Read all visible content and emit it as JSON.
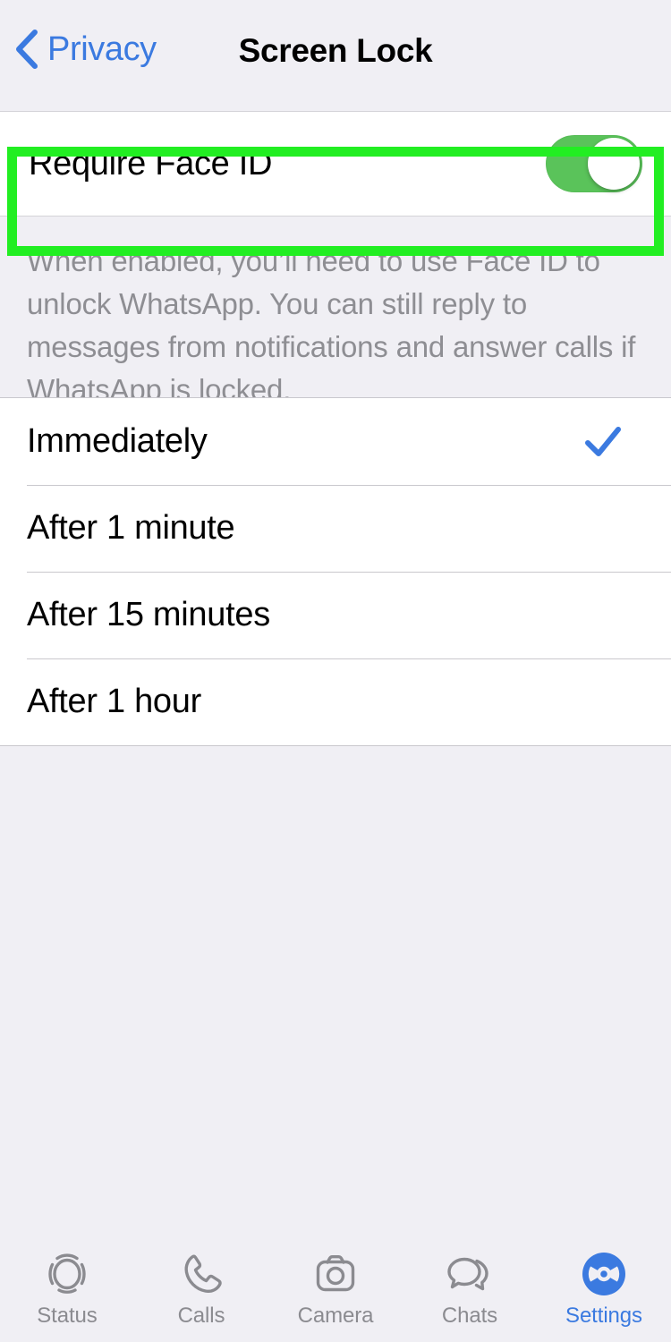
{
  "navbar": {
    "back_label": "Privacy",
    "back_icon": "chevron-left-icon",
    "title": "Screen Lock"
  },
  "face_id_setting": {
    "label": "Require Face ID",
    "toggle_state": "on",
    "toggle_on_color": "#5ac35a",
    "highlighted": true,
    "highlight_color": "#22ee22",
    "description": "When enabled, you’ll need to use Face ID to unlock WhatsApp. You can still reply to messages from notifications and answer calls if WhatsApp is locked."
  },
  "lock_timing": {
    "selected": "Immediately",
    "check_color": "#3b7ae0",
    "options": [
      {
        "label": "Immediately",
        "selected": true
      },
      {
        "label": "After 1 minute",
        "selected": false
      },
      {
        "label": "After 15 minutes",
        "selected": false
      },
      {
        "label": "After 1 hour",
        "selected": false
      }
    ]
  },
  "tabbar": {
    "active": "Settings",
    "active_color": "#3b7ae0",
    "inactive_color": "#8b8b90",
    "items": [
      {
        "label": "Status",
        "icon": "status-rings-icon",
        "active": false
      },
      {
        "label": "Calls",
        "icon": "phone-icon",
        "active": false
      },
      {
        "label": "Camera",
        "icon": "camera-icon",
        "active": false
      },
      {
        "label": "Chats",
        "icon": "chat-bubbles-icon",
        "active": false
      },
      {
        "label": "Settings",
        "icon": "gear-icon",
        "active": true
      }
    ]
  }
}
